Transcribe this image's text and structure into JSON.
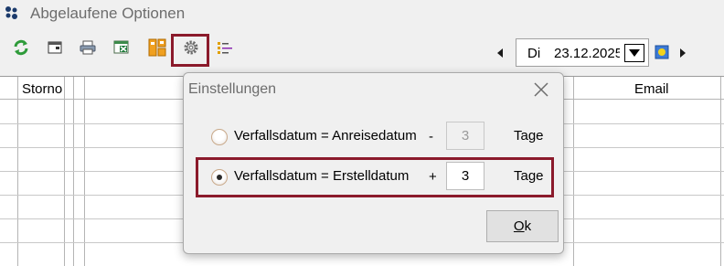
{
  "window": {
    "title": "Abgelaufene Optionen",
    "icon": "app-dots-icon"
  },
  "toolbar": {
    "buttons": [
      {
        "name": "refresh-icon"
      },
      {
        "name": "window-icon"
      },
      {
        "name": "print-icon"
      },
      {
        "name": "excel-export-icon"
      },
      {
        "name": "layout-icon"
      },
      {
        "name": "settings-gear-icon"
      },
      {
        "name": "column-config-icon"
      }
    ],
    "date": {
      "day": "Di",
      "value": "23.12.2025"
    }
  },
  "grid": {
    "columns": [
      "Storno",
      "Email"
    ]
  },
  "dialog": {
    "title": "Einstellungen",
    "options": [
      {
        "label": "Verfallsdatum = Anreisedatum",
        "operator": "-",
        "value": "3",
        "unit": "Tage",
        "checked": false,
        "enabled": false
      },
      {
        "label": "Verfallsdatum = Erstelldatum",
        "operator": "+",
        "value": "3",
        "unit": "Tage",
        "checked": true,
        "enabled": true
      }
    ],
    "ok": "Ok",
    "colors": {
      "highlight": "#8b1a2b"
    }
  }
}
